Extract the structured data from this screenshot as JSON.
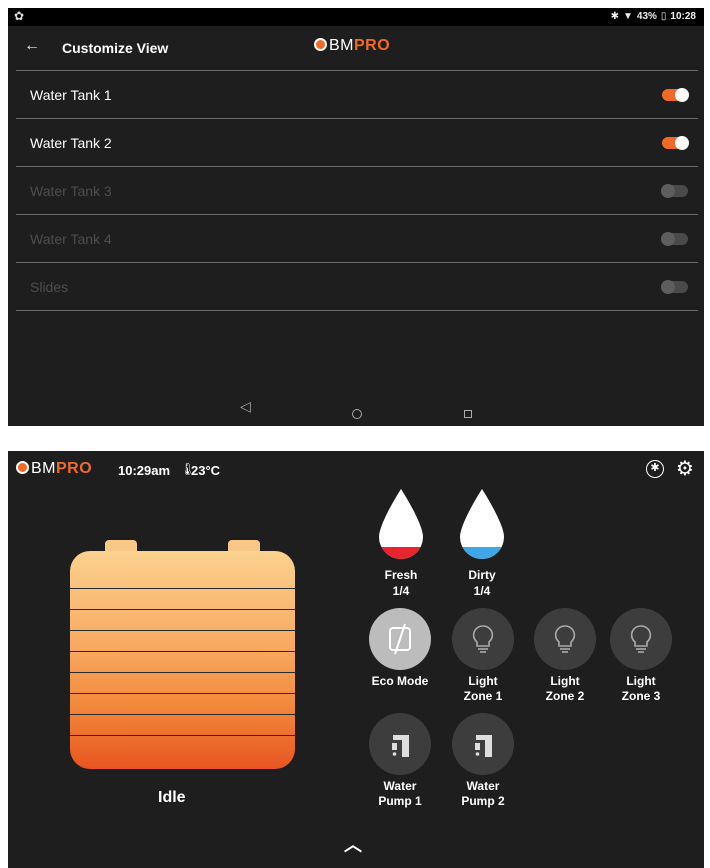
{
  "settings_screen": {
    "status_bar": {
      "time": "10:28",
      "battery": "43%"
    },
    "header": {
      "title": "Customize View",
      "brand_bm": "BM",
      "brand_pro": "PRO"
    },
    "rows": [
      {
        "label": "Water Tank 1",
        "enabled": true
      },
      {
        "label": "Water Tank 2",
        "enabled": true
      },
      {
        "label": "Water Tank 3",
        "enabled": false
      },
      {
        "label": "Water Tank 4",
        "enabled": false
      },
      {
        "label": "Slides",
        "enabled": false
      }
    ]
  },
  "dashboard": {
    "brand_bm": "BM",
    "brand_pro": "PRO",
    "time": "10:29am",
    "temperature": "23°C",
    "battery_status": "Idle",
    "tanks": [
      {
        "name": "Fresh",
        "level": "1/4",
        "color": "#e8242e"
      },
      {
        "name": "Dirty",
        "level": "1/4",
        "color": "#3fa7e8"
      }
    ],
    "controls_row1": [
      {
        "line1": "Eco Mode",
        "line2": "",
        "icon": "eco-off-icon",
        "active": true
      },
      {
        "line1": "Light",
        "line2": "Zone 1",
        "icon": "bulb-icon",
        "active": false
      },
      {
        "line1": "Light",
        "line2": "Zone 2",
        "icon": "bulb-icon",
        "active": false
      },
      {
        "line1": "Light",
        "line2": "Zone 3",
        "icon": "bulb-icon",
        "active": false
      }
    ],
    "controls_row2": [
      {
        "line1": "Water",
        "line2": "Pump 1",
        "icon": "tap-icon",
        "active": false
      },
      {
        "line1": "Water",
        "line2": "Pump 2",
        "icon": "tap-icon",
        "active": false
      }
    ]
  },
  "colors": {
    "accent": "#f06a25",
    "background": "#1e1e1e",
    "tile": "#3d3d3d"
  }
}
